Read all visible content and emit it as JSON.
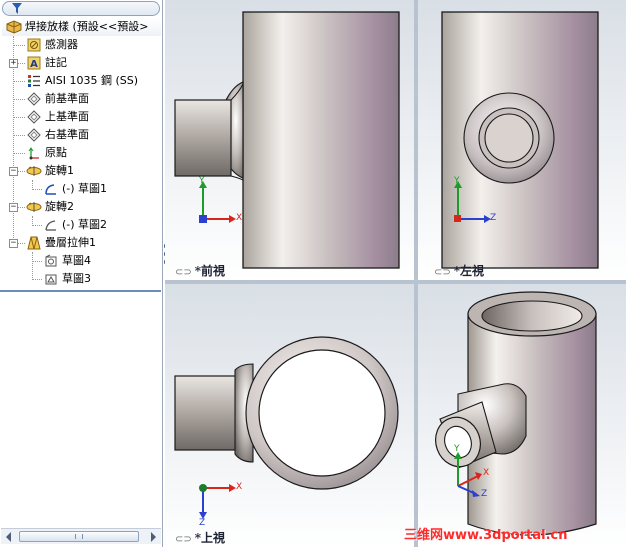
{
  "tree": {
    "filter_icon": "funnel-icon",
    "root": {
      "label": "焊接放樣 (預設<<預設>",
      "icon": "part-icon"
    },
    "items": [
      {
        "label": "感測器",
        "icon": "sensor-icon"
      },
      {
        "label": "註記",
        "icon": "annotation-icon"
      },
      {
        "label": "AISI 1035 鋼 (SS)",
        "icon": "material-icon"
      },
      {
        "label": "前基準面",
        "icon": "plane-icon"
      },
      {
        "label": "上基準面",
        "icon": "plane-icon"
      },
      {
        "label": "右基準面",
        "icon": "plane-icon"
      },
      {
        "label": "原點",
        "icon": "origin-icon"
      },
      {
        "label": "旋轉1",
        "icon": "revolve-icon"
      },
      {
        "label": "(-) 草圖1",
        "icon": "sketch-icon"
      },
      {
        "label": "旋轉2",
        "icon": "revolve-icon"
      },
      {
        "label": "(-) 草圖2",
        "icon": "sketch-icon"
      },
      {
        "label": "疊層拉伸1",
        "icon": "loft-icon"
      },
      {
        "label": "草圖4",
        "icon": "sketch-icon"
      },
      {
        "label": "草圖3",
        "icon": "sketch-icon"
      }
    ]
  },
  "viewports": {
    "front": {
      "label": "*前視"
    },
    "left": {
      "label": "*左視"
    },
    "top": {
      "label": "*上視"
    },
    "iso": {
      "label": ""
    }
  },
  "triad": {
    "x": "X",
    "y": "Y",
    "z": "Z"
  },
  "watermark": "三维网www.3dportal.cn",
  "colors": {
    "x_axis": "#d9261c",
    "y_axis": "#1f9b2a",
    "z_axis": "#2b3fd0",
    "watermark": "#ff2a2a"
  }
}
